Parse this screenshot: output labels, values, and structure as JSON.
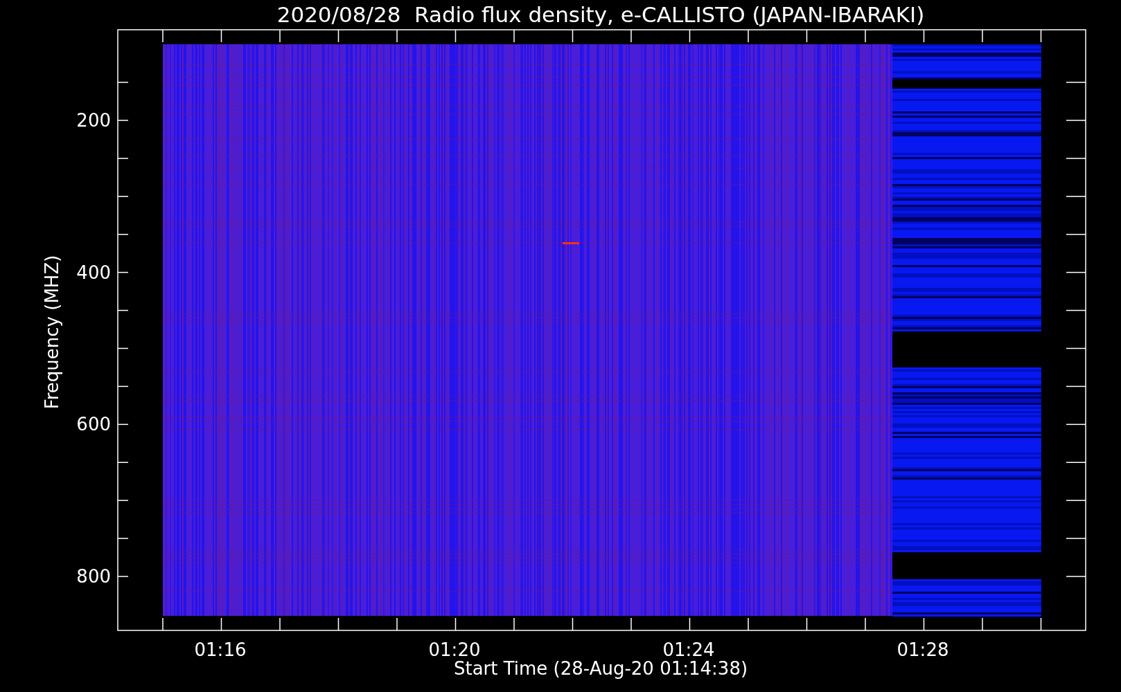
{
  "title": "2020/08/28  Radio flux density, e-CALLISTO (JAPAN-IBARAKI)",
  "y_axis": {
    "label": "Frequency (MHZ)",
    "ticks": [
      "200",
      "400",
      "600",
      "800"
    ]
  },
  "x_axis": {
    "label": "Start Time (28-Aug-20 01:14:38)",
    "ticks": [
      "01:16",
      "01:20",
      "01:24",
      "01:28"
    ]
  }
}
